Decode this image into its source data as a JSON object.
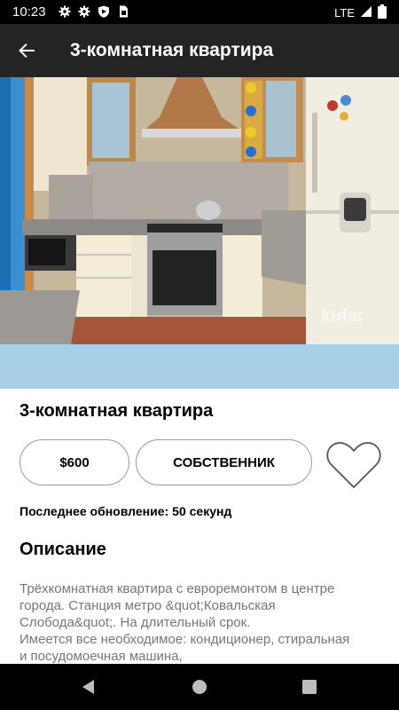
{
  "status_bar": {
    "time": "10:23",
    "network": "LTE",
    "icons": [
      "gear-icon",
      "gear-icon",
      "shield-icon",
      "sim-card-icon"
    ]
  },
  "app_bar": {
    "title": "3-комнатная квартира",
    "back_icon": "arrow-back-icon"
  },
  "listing": {
    "photo_watermark": "kufar",
    "title": "3-комнатная квартира",
    "price": "$600",
    "seller_type": "СОБСТВЕННИК",
    "favorite_icon": "heart-outline-icon",
    "updated_label": "Последнее обновление:",
    "updated_value": "50 секунд",
    "description_heading": "Описание",
    "description": "Трёхкомнатная квартира с евроремонтом в центре города. Станция метро &quot;Ковальская Слобода&quot;. На длительный срок.\nИмеется все необходимое: кондиционер, стиральная и посудомоечная машина,"
  },
  "colors": {
    "app_bar": "#242424",
    "pager_bar": "#a8d1e9",
    "pill_border": "#9a9a9a",
    "description_text": "#777777"
  },
  "nav_bar": {
    "icons": [
      "back-triangle-icon",
      "home-circle-icon",
      "recents-square-icon"
    ]
  }
}
